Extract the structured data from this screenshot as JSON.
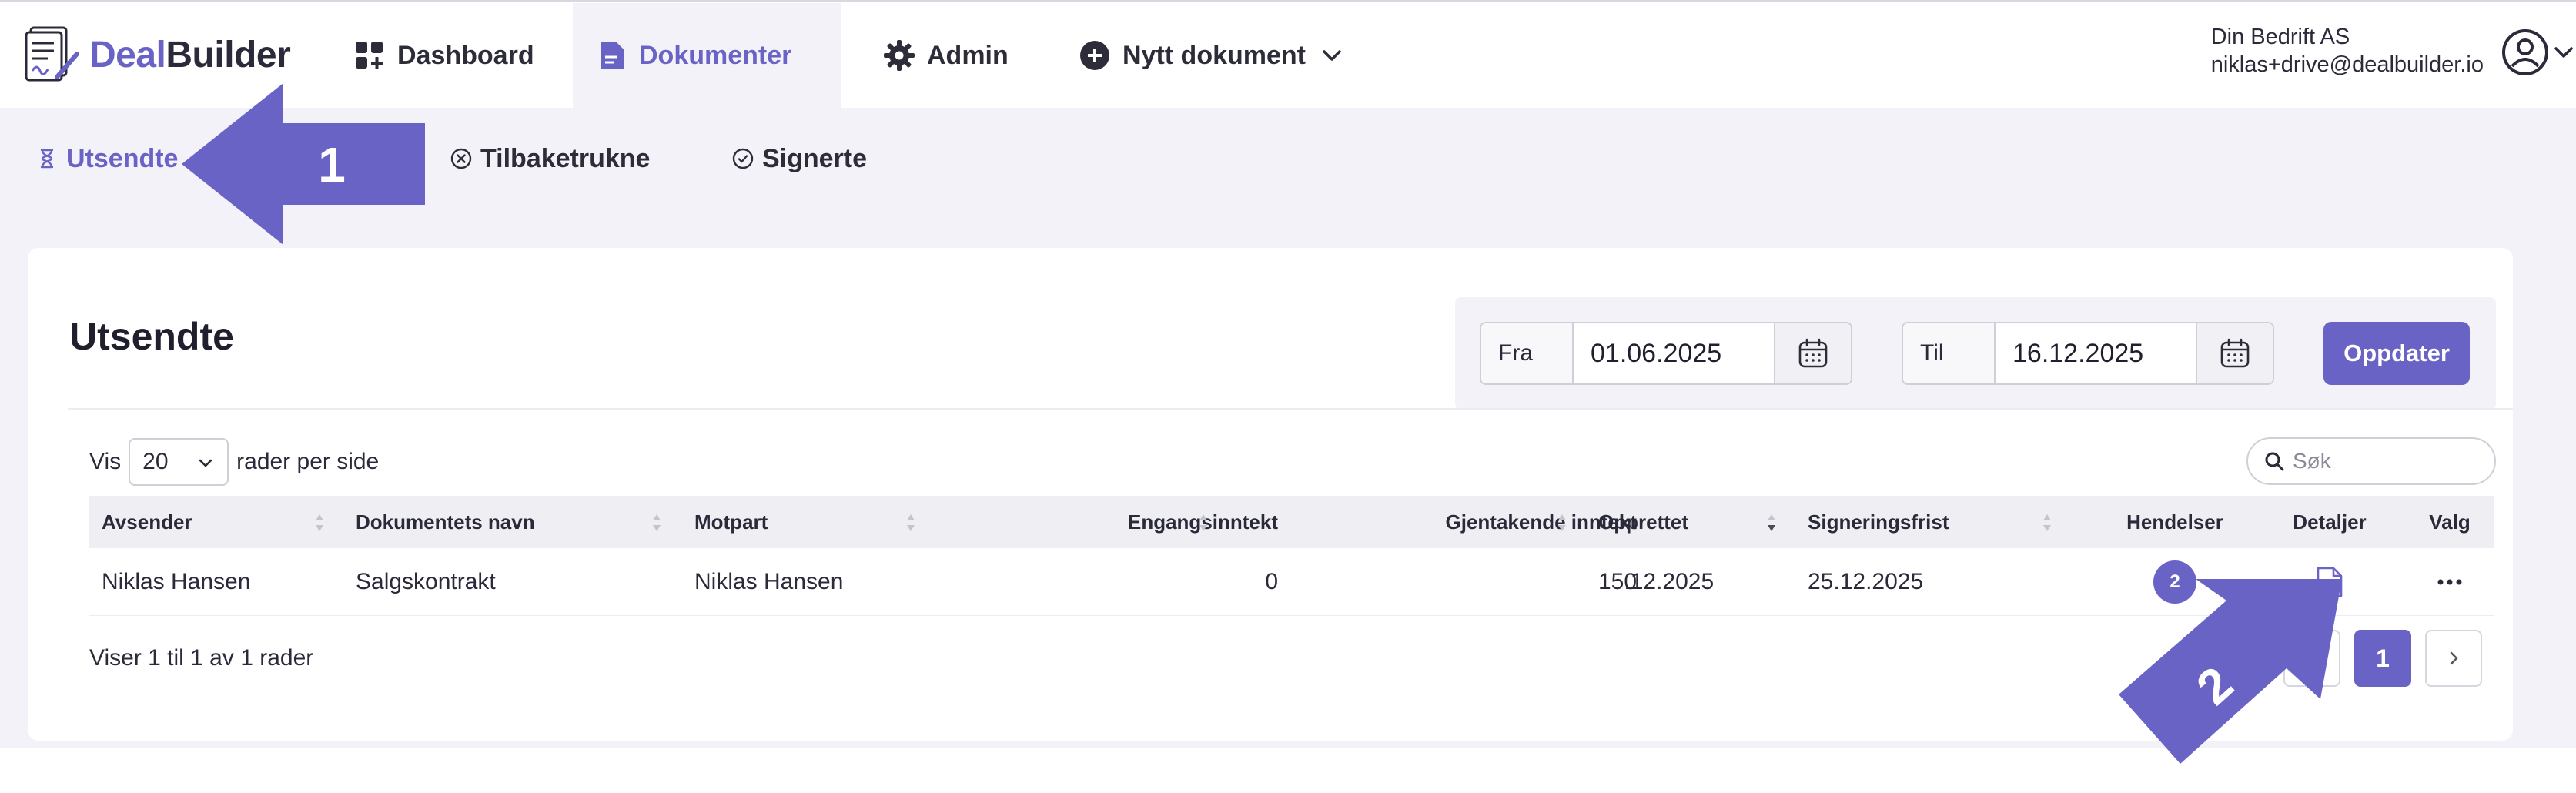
{
  "app": {
    "logo_part1": "Deal",
    "logo_part2": "Builder",
    "logo_icon": "document-signature-icon"
  },
  "nav": {
    "items": [
      {
        "label": "Dashboard",
        "icon": "dashboard-icon"
      },
      {
        "label": "Dokumenter",
        "icon": "document-icon",
        "active": true
      },
      {
        "label": "Admin",
        "icon": "gear-icon"
      },
      {
        "label": "Nytt dokument",
        "icon": "plus-circle-icon"
      }
    ]
  },
  "account": {
    "company": "Din Bedrift AS",
    "email": "niklas+drive@dealbuilder.io"
  },
  "subnav": {
    "tabs": [
      {
        "label": "Utsendte",
        "icon": "hourglass-icon",
        "active": true
      },
      {
        "label": "Tilbaketrukne",
        "icon": "x-circle-icon"
      },
      {
        "label": "Signerte",
        "icon": "check-circle-icon"
      }
    ]
  },
  "main": {
    "title": "Utsendte",
    "filter": {
      "from_label": "Fra",
      "from_value": "01.06.2025",
      "to_label": "Til",
      "to_value": "16.12.2025",
      "update_label": "Oppdater"
    },
    "rows_control": {
      "prefix": "Vis",
      "value": "20",
      "suffix": "rader per side"
    },
    "search_placeholder": "Søk",
    "table": {
      "columns": [
        "Avsender",
        "Dokumentets navn",
        "Motpart",
        "Engangsinntekt",
        "Gjentakende inntekt",
        "Opprettet",
        "Signeringsfrist",
        "Hendelser",
        "Detaljer",
        "Valg"
      ],
      "rows": [
        {
          "avsender": "Niklas Hansen",
          "dokument": "Salgskontrakt",
          "motpart": "Niklas Hansen",
          "engangsinntekt": "0",
          "gjentakende": "0",
          "opprettet": "15.12.2025",
          "signeringsfrist": "25.12.2025",
          "hendelser": "2"
        }
      ]
    },
    "footer_info": "Viser 1 til 1 av 1 rader",
    "pager_current": "1"
  },
  "annotations": {
    "arrow1_label": "1",
    "arrow2_label": "2"
  },
  "colors": {
    "accent": "#6a63c6",
    "header_bg": "#f3f2f8"
  }
}
